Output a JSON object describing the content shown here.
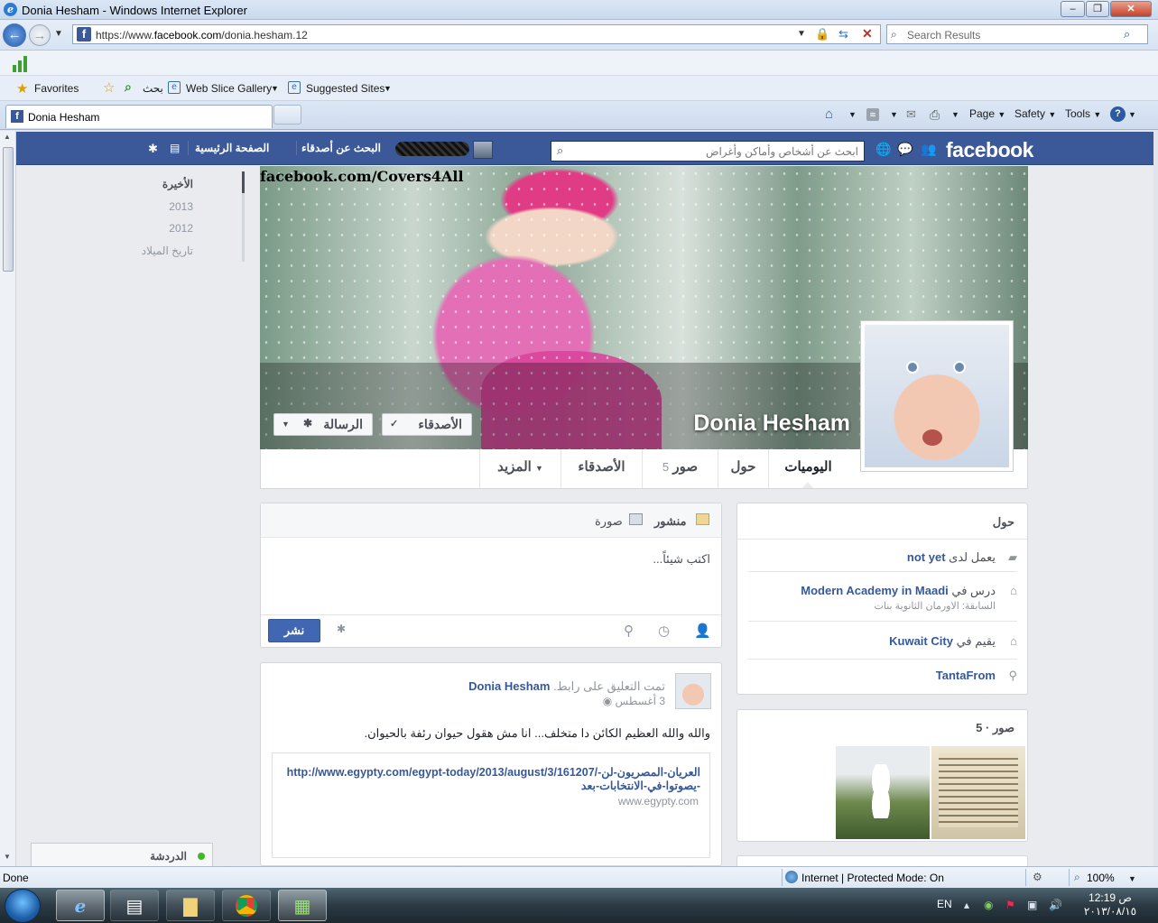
{
  "window": {
    "title": "Donia Hesham - Windows Internet Explorer"
  },
  "address": {
    "url_prefix": "https://www.",
    "url_domain": "facebook.com",
    "url_path": "/donia.hesham.12",
    "search_placeholder": "Search Results"
  },
  "favorites_bar": {
    "favorites": "Favorites",
    "search": "بحث",
    "web_slice": "Web Slice Gallery",
    "suggested": "Suggested Sites"
  },
  "tabs": [
    {
      "label": "Donia Hesham"
    }
  ],
  "command_bar": {
    "page": "Page",
    "safety": "Safety",
    "tools": "Tools"
  },
  "fb": {
    "logo": "facebook",
    "search_placeholder": "ابحث عن أشخاص وأماكن وأغراض",
    "nav_find_friends": "البحث عن أصدقاء",
    "nav_home": "الصفحة الرئيسية",
    "years": [
      "الأخيرة",
      "2013",
      "2012",
      "تاريخ الميلاد"
    ],
    "watermark": "facebook.com/Covers4All",
    "profile_name": "Donia Hesham",
    "btn_friends": "الأصدقاء",
    "btn_message": "الرسالة",
    "profile_tabs": {
      "timeline": "اليوميات",
      "about": "حول",
      "photos": "صور",
      "photos_count": "5",
      "friends": "الأصدقاء",
      "more": "المزيد"
    },
    "composer": {
      "tab_status": "منشور",
      "tab_photo": "صورة",
      "placeholder": "اكتب شيئاً...",
      "post_button": "نشر"
    },
    "post": {
      "author": "Donia Hesham",
      "action": "تمت التعليق على رابط.",
      "date": "3 أغسطس",
      "text": "والله والله العظيم الكائن دا متخلف... انا مش هقول حيوان رئفة بالحيوان.",
      "link_url": "http://www.egypty.com/egypt-today/2013/august/3/161207/العريان-المصريون-لن-يصوتوا-في-الانتخابات-بعد-",
      "link_domain": "www.egypty.com"
    },
    "about": {
      "title": "حول",
      "work_prefix": "يعمل لدى",
      "work_value": "not yet",
      "study_prefix": "درس في",
      "study_value": "Modern Academy in Maadi",
      "study_sub": "السابقة: الاورمان الثانوية بنات",
      "lives_prefix": "يقيم في",
      "lives_value": "Kuwait City",
      "from_value": "TantaFrom"
    },
    "photos": {
      "title": "صور · 5"
    },
    "chat": {
      "label": "الدردشة"
    }
  },
  "statusbar": {
    "done": "Done",
    "zone": "Internet | Protected Mode: On",
    "zoom": "100%"
  },
  "taskbar": {
    "lang": "EN",
    "time": "12:19 ص",
    "date": "٢٠١٣/٠٨/١٥"
  }
}
